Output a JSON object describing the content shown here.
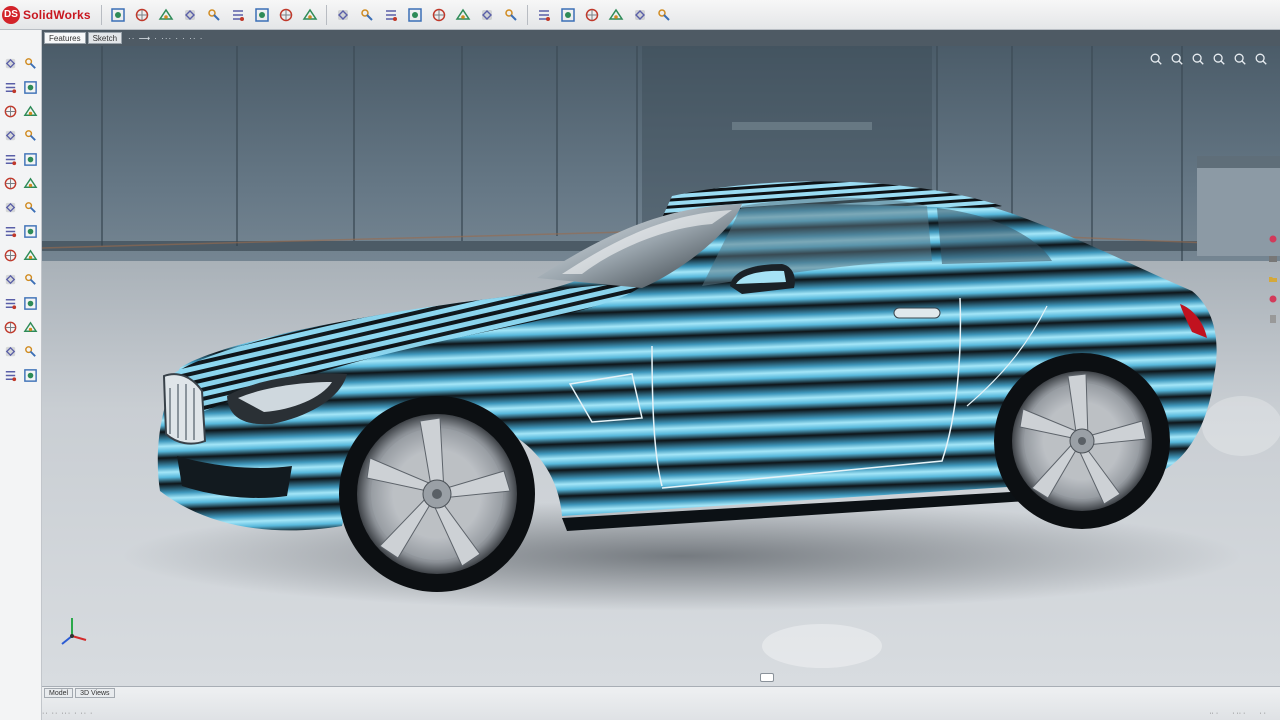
{
  "app": {
    "name": "SolidWorks",
    "logo_text": "DS"
  },
  "toolbar": {
    "icons": [
      "new-document",
      "open-file",
      "save",
      "print",
      "undo",
      "redo",
      "select",
      "rebuild",
      "options",
      "zoom-to-fit",
      "zoom-area",
      "rotate-view",
      "pan",
      "section-view",
      "display-style",
      "hide-show",
      "edit-appearance",
      "apply-scene",
      "view-settings",
      "camera",
      "render-tools",
      "photoview",
      "evaluate"
    ]
  },
  "tabs": {
    "items": [
      "Features",
      "Sketch"
    ],
    "doc_path": "··  ⟶ ·  ··· ·  · ·· ·"
  },
  "left_panel": {
    "count": 28
  },
  "heads_up": {
    "icons": [
      "zoom-to-fit",
      "zoom-area",
      "previous-view",
      "section-view",
      "view-orientation",
      "display-style"
    ]
  },
  "statusbar": {
    "tabs": [
      "Model",
      "3D Views"
    ],
    "left_text": "·· ·· ··· ·  ·· ·",
    "right_items": [
      "·· ·",
      "· ·· ·",
      "· ·"
    ]
  },
  "colors": {
    "accent": "#c8171f",
    "car_stripe_light": "#7fd4ef",
    "car_stripe_dark": "#0d1216",
    "wall": "#5d6f7d",
    "floor": "#c7ccd1"
  }
}
